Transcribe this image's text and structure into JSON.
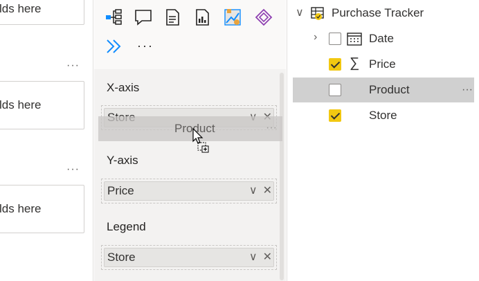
{
  "left_pane": {
    "boxes": [
      "lds here",
      "lds here",
      "lds here"
    ],
    "more": "···"
  },
  "viz_pane": {
    "more_visuals": "···",
    "wells": [
      {
        "label": "X-axis",
        "field": "Store"
      },
      {
        "label": "Y-axis",
        "field": "Price"
      },
      {
        "label": "Legend",
        "field": "Store"
      }
    ],
    "drag_ghost": "Product",
    "chip_expand": "∨",
    "chip_remove": "✕"
  },
  "fields_pane": {
    "table": "Purchase Tracker",
    "fields": [
      {
        "name": "Date",
        "checked": false,
        "expandable": true
      },
      {
        "name": "Price",
        "checked": true,
        "sigma": true
      },
      {
        "name": "Product",
        "checked": false,
        "selected": true
      },
      {
        "name": "Store",
        "checked": true
      }
    ],
    "more": "···"
  },
  "colors": {
    "accent": "#f2c811",
    "pane_bg": "#f3f2f1",
    "selected_row": "#d0d0d0"
  }
}
